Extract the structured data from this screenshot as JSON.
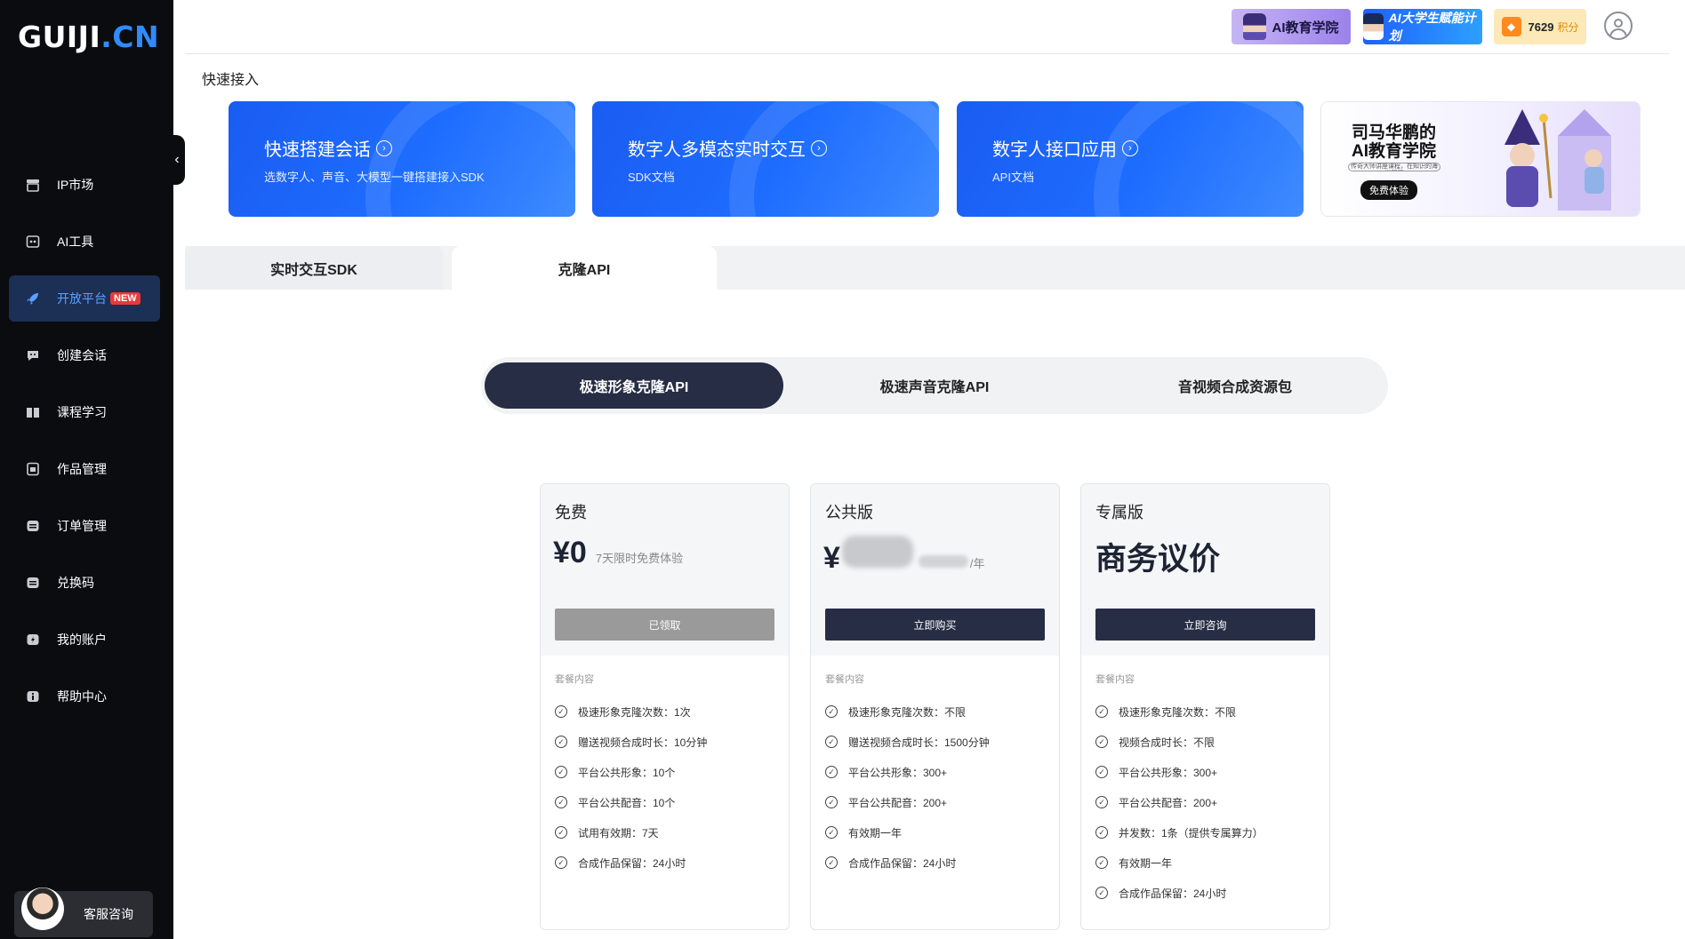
{
  "sidebar": {
    "logo_main": "GUIJI",
    "logo_suffix": ".CN",
    "collapse_glyph": "‹",
    "items": [
      {
        "label": "IP市场",
        "icon": "store-icon"
      },
      {
        "label": "AI工具",
        "icon": "robot-icon"
      },
      {
        "label": "开放平台",
        "icon": "rocket-icon",
        "badge": "NEW",
        "active": true
      },
      {
        "label": "创建会话",
        "icon": "chat-icon"
      },
      {
        "label": "课程学习",
        "icon": "book-icon"
      },
      {
        "label": "作品管理",
        "icon": "file-icon"
      },
      {
        "label": "订单管理",
        "icon": "order-icon"
      },
      {
        "label": "兑换码",
        "icon": "ticket-icon"
      },
      {
        "label": "我的账户",
        "icon": "account-icon"
      },
      {
        "label": "帮助中心",
        "icon": "info-icon"
      }
    ],
    "support_label": "客服咨询"
  },
  "header": {
    "academy_label": "AI教育学院",
    "student_label": "AI大学生赋能计划",
    "points_value": "7629",
    "points_unit": "积分"
  },
  "quick_access": {
    "title": "快速接入",
    "cards": [
      {
        "title": "快速搭建会话",
        "subtitle": "选数字人、声音、大模型一键搭建接入SDK"
      },
      {
        "title": "数字人多模态实时交互",
        "subtitle": "SDK文档"
      },
      {
        "title": "数字人接口应用",
        "subtitle": "API文档"
      }
    ],
    "promo": {
      "title_line1": "司马华鹏的",
      "title_line2": "AI教育学院",
      "subtitle": "传奇大师讲座课程，在知识的海洋翱翔",
      "button": "免费体验"
    }
  },
  "tabs": [
    {
      "label": "实时交互SDK"
    },
    {
      "label": "克隆API",
      "active": true
    }
  ],
  "segments": [
    {
      "label": "极速形象克隆API",
      "active": true
    },
    {
      "label": "极速声音克隆API"
    },
    {
      "label": "音视频合成资源包"
    }
  ],
  "plans": [
    {
      "name": "免费",
      "currency": "¥",
      "price": "0",
      "note": "7天限时免费体验",
      "button": "已领取",
      "list_title": "套餐内容",
      "features": [
        "极速形象克隆次数：1次",
        "赠送视频合成时长：10分钟",
        "平台公共形象：10个",
        "平台公共配音：10个",
        "试用有效期：7天",
        "合成作品保留：24小时"
      ]
    },
    {
      "name": "公共版",
      "currency": "¥",
      "per_unit": "/年",
      "button": "立即购买",
      "list_title": "套餐内容",
      "features": [
        "极速形象克隆次数：不限",
        "赠送视频合成时长：1500分钟",
        "平台公共形象：300+",
        "平台公共配音：200+",
        "有效期一年",
        "合成作品保留：24小时"
      ]
    },
    {
      "name": "专属版",
      "price_text": "商务议价",
      "button": "立即咨询",
      "list_title": "套餐内容",
      "features": [
        "极速形象克隆次数：不限",
        "视频合成时长：不限",
        "平台公共形象：300+",
        "平台公共配音：200+",
        "并发数：1条（提供专属算力）",
        "有效期一年",
        "合成作品保留：24小时"
      ]
    }
  ],
  "colors": {
    "sidebar_bg": "#0b0c10",
    "accent_blue": "#1e6dff",
    "active_nav_bg": "#1c2f55",
    "dark_button": "#262d44",
    "badge_red": "#e63a3a",
    "points_bg": "#fde9b8"
  }
}
